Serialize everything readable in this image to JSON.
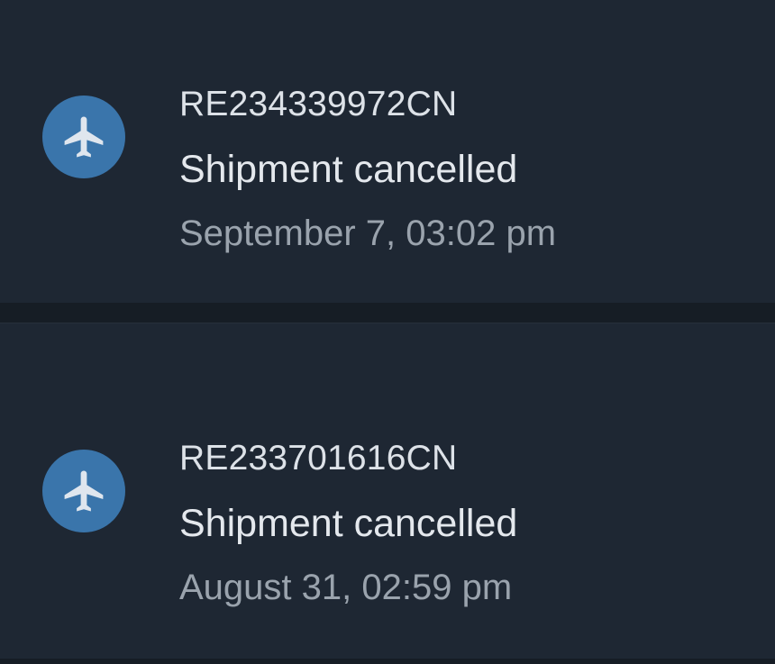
{
  "shipments": [
    {
      "tracking_number": "RE234339972CN",
      "status": "Shipment cancelled",
      "date": "September 7, 03:02 pm",
      "icon": "airplane-icon"
    },
    {
      "tracking_number": "RE233701616CN",
      "status": "Shipment cancelled",
      "date": "August 31, 02:59 pm",
      "icon": "airplane-icon"
    }
  ],
  "colors": {
    "background": "#1e2733",
    "icon_circle": "#3a75ab",
    "primary_text": "#e4e8ed",
    "secondary_text": "#9aa3ad"
  }
}
